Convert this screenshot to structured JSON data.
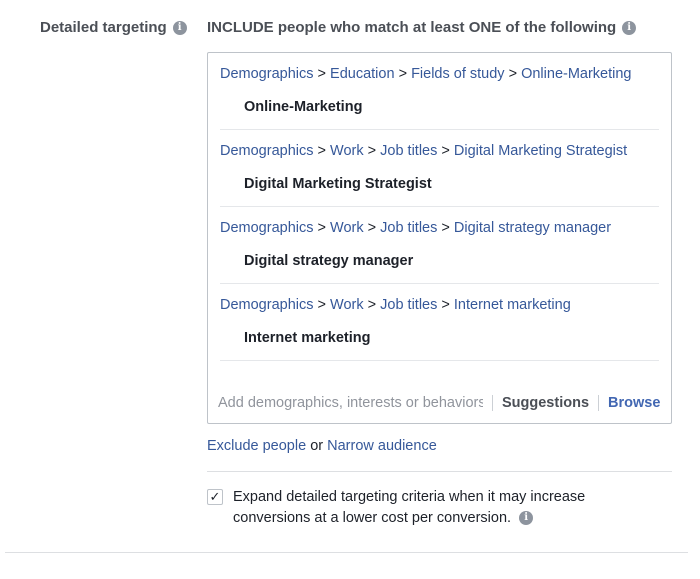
{
  "section_label": "Detailed targeting",
  "include_header": "INCLUDE people who match at least ONE of the following",
  "items": [
    {
      "path": [
        "Demographics",
        "Education",
        "Fields of study",
        "Online-Marketing"
      ],
      "title": "Online-Marketing"
    },
    {
      "path": [
        "Demographics",
        "Work",
        "Job titles",
        "Digital Marketing Strategist"
      ],
      "title": "Digital Marketing Strategist"
    },
    {
      "path": [
        "Demographics",
        "Work",
        "Job titles",
        "Digital strategy manager"
      ],
      "title": "Digital strategy manager"
    },
    {
      "path": [
        "Demographics",
        "Work",
        "Job titles",
        "Internet marketing"
      ],
      "title": "Internet marketing"
    }
  ],
  "path_separator": ">",
  "search": {
    "placeholder": "Add demographics, interests or behaviors",
    "suggestions_label": "Suggestions",
    "browse_label": "Browse"
  },
  "exclude": {
    "exclude_label": "Exclude people",
    "or_text": "or",
    "narrow_label": "Narrow audience"
  },
  "expand": {
    "checked": true,
    "text": "Expand detailed targeting criteria when it may increase conversions at a lower cost per conversion."
  },
  "colors": {
    "link": "#365899",
    "browse": "#4267b2",
    "label": "#4b4f56",
    "border": "#bec3c9"
  }
}
